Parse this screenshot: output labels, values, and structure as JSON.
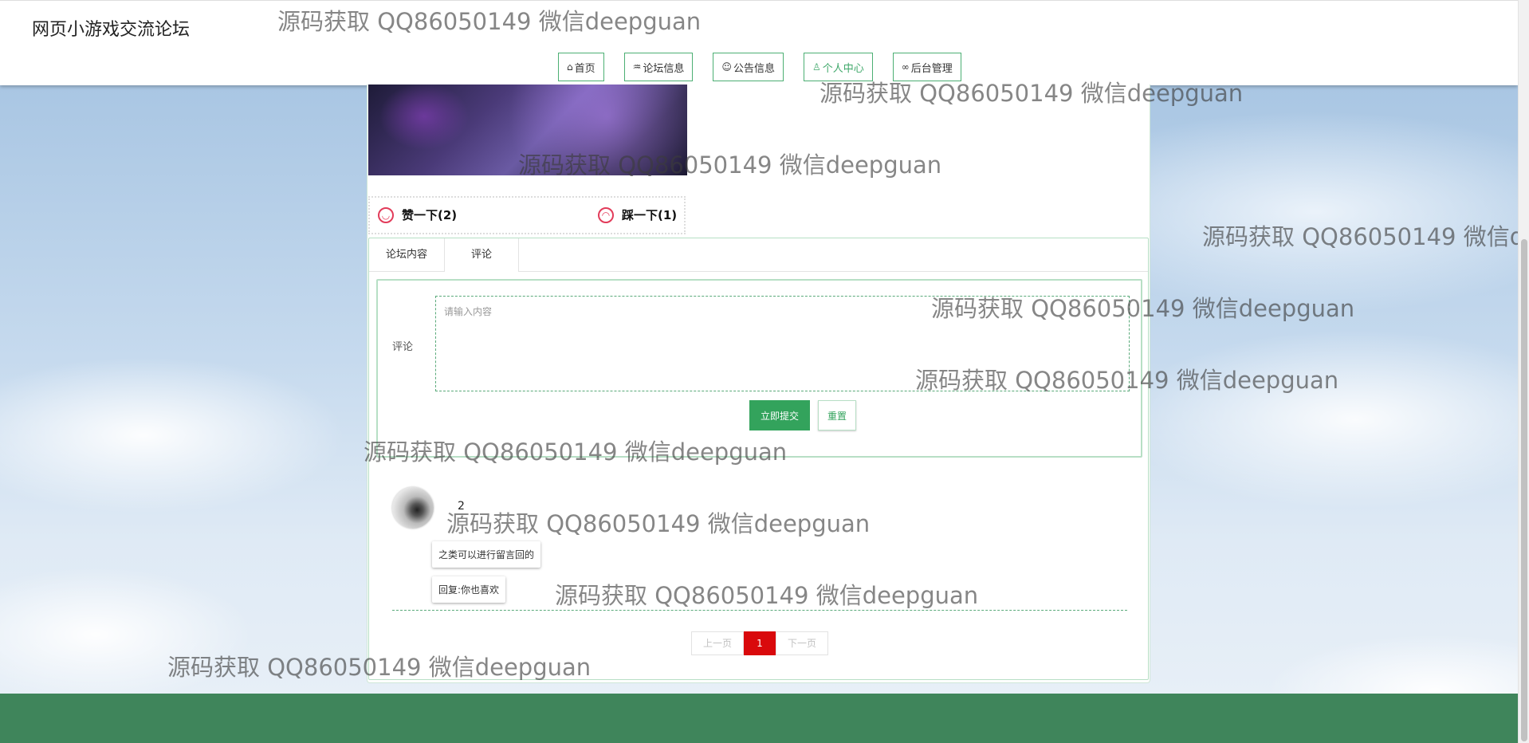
{
  "header": {
    "site_title": "网页小游戏交流论坛",
    "nav": [
      {
        "icon": "home-icon",
        "glyph": "⌂",
        "label": "首页"
      },
      {
        "icon": "forum-icon",
        "glyph": "♒",
        "label": "论坛信息"
      },
      {
        "icon": "notice-icon",
        "glyph": "☺",
        "label": "公告信息"
      },
      {
        "icon": "user-icon",
        "glyph": "♙",
        "label": "个人中心"
      },
      {
        "icon": "link-icon",
        "glyph": "∞",
        "label": "后台管理"
      }
    ]
  },
  "votes": {
    "like_label": "赞一下(2)",
    "dislike_label": "踩一下(1)"
  },
  "tabs": [
    {
      "label": "论坛内容"
    },
    {
      "label": "评论"
    }
  ],
  "comment_form": {
    "label": "评论",
    "placeholder": "请输入内容",
    "submit_label": "立即提交",
    "reset_label": "重置"
  },
  "comments": [
    {
      "user": "2",
      "content": "之类可以进行留言回的",
      "reply": "回复:你也喜欢"
    }
  ],
  "pager": {
    "prev_label": "上一页",
    "current": "1",
    "next_label": "下一页"
  },
  "watermark": "源码获取 QQ86050149 微信deepguan",
  "colors": {
    "accent_green": "#33a35c",
    "footer_green": "#3f855b",
    "pager_red": "#d9090c",
    "vote_icon_red": "#e23c5a"
  }
}
